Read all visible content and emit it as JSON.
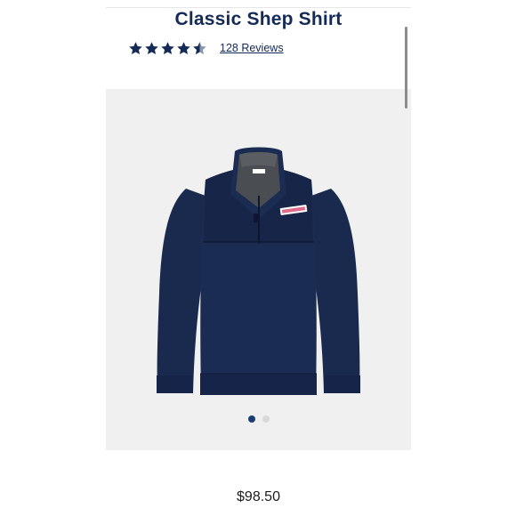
{
  "product": {
    "title": "Classic Shep Shirt",
    "rating": 4.5,
    "rating_max": 5,
    "reviews_label": "128 Reviews",
    "price": "$98.50"
  },
  "gallery": {
    "image_icon": "quarter-zip-pullover",
    "slide_count": 2,
    "active_slide": 1
  },
  "colors": {
    "title": "#142a57",
    "star": "#142a57",
    "active_dot": "#1c3d73",
    "inactive_dot": "#d9d9d9",
    "garment": "#1a2a4f",
    "collar": "#4a4d52"
  }
}
